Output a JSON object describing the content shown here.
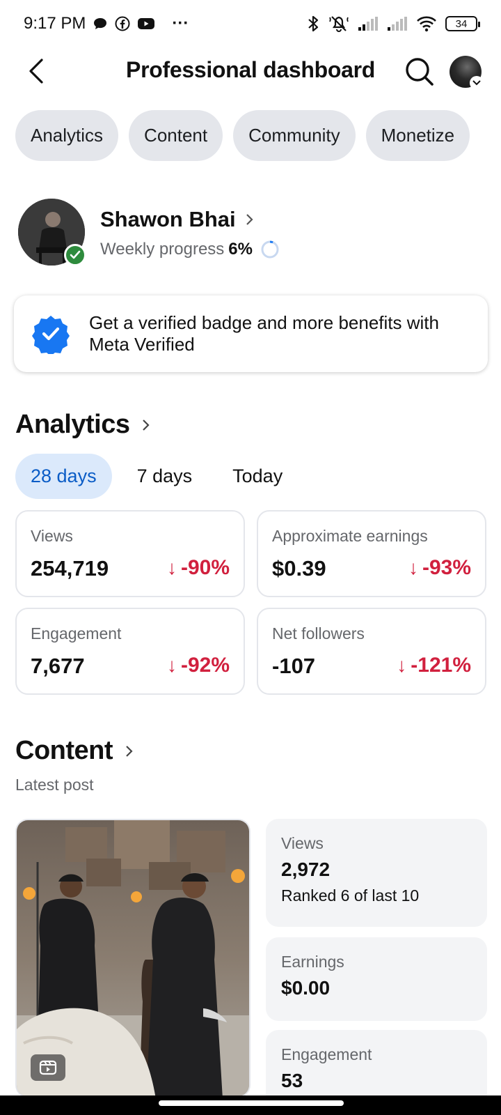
{
  "status_bar": {
    "time": "9:17 PM",
    "more": "···",
    "battery": "34",
    "icons": [
      "chat-bubble-icon",
      "facebook-icon",
      "youtube-icon",
      "bluetooth-icon",
      "mute-icon",
      "signal-icon",
      "signal-icon",
      "wifi-icon",
      "battery-icon"
    ]
  },
  "header": {
    "title": "Professional dashboard",
    "icons": [
      "back-arrow-icon",
      "search-icon",
      "avatar"
    ]
  },
  "chips": [
    {
      "label": "Analytics"
    },
    {
      "label": "Content"
    },
    {
      "label": "Community"
    },
    {
      "label": "Monetize"
    }
  ],
  "profile": {
    "name": "Shawon Bhai",
    "progress_label": "Weekly progress",
    "progress_value": "6%",
    "progress_fraction": 0.06
  },
  "verified_card": {
    "text_line1": "Get a verified badge and more benefits with",
    "text_line2": "Meta Verified"
  },
  "analytics": {
    "title": "Analytics",
    "ranges": [
      {
        "label": "28 days",
        "active": true
      },
      {
        "label": "7 days",
        "active": false
      },
      {
        "label": "Today",
        "active": false
      }
    ],
    "metrics": [
      {
        "label": "Views",
        "value": "254,719",
        "change": "-90%"
      },
      {
        "label": "Approximate earnings",
        "value": "$0.39",
        "change": "-93%"
      },
      {
        "label": "Engagement",
        "value": "7,677",
        "change": "-92%"
      },
      {
        "label": "Net followers",
        "value": "-107",
        "change": "-121%"
      }
    ]
  },
  "content": {
    "title": "Content",
    "latest_label": "Latest post",
    "stats": {
      "views_label": "Views",
      "views_value": "2,972",
      "views_rank": "Ranked 6 of last 10",
      "earnings_label": "Earnings",
      "earnings_value": "$0.00",
      "engagement_label": "Engagement",
      "engagement_value": "53"
    }
  },
  "colors": {
    "chip_bg": "#e4e6eb",
    "active_tab_bg": "#dbe9fb",
    "active_tab_text": "#0a5cc6",
    "negative": "#d1203e",
    "verified_blue": "#1877f2",
    "verified_green": "#2e8b3d"
  }
}
